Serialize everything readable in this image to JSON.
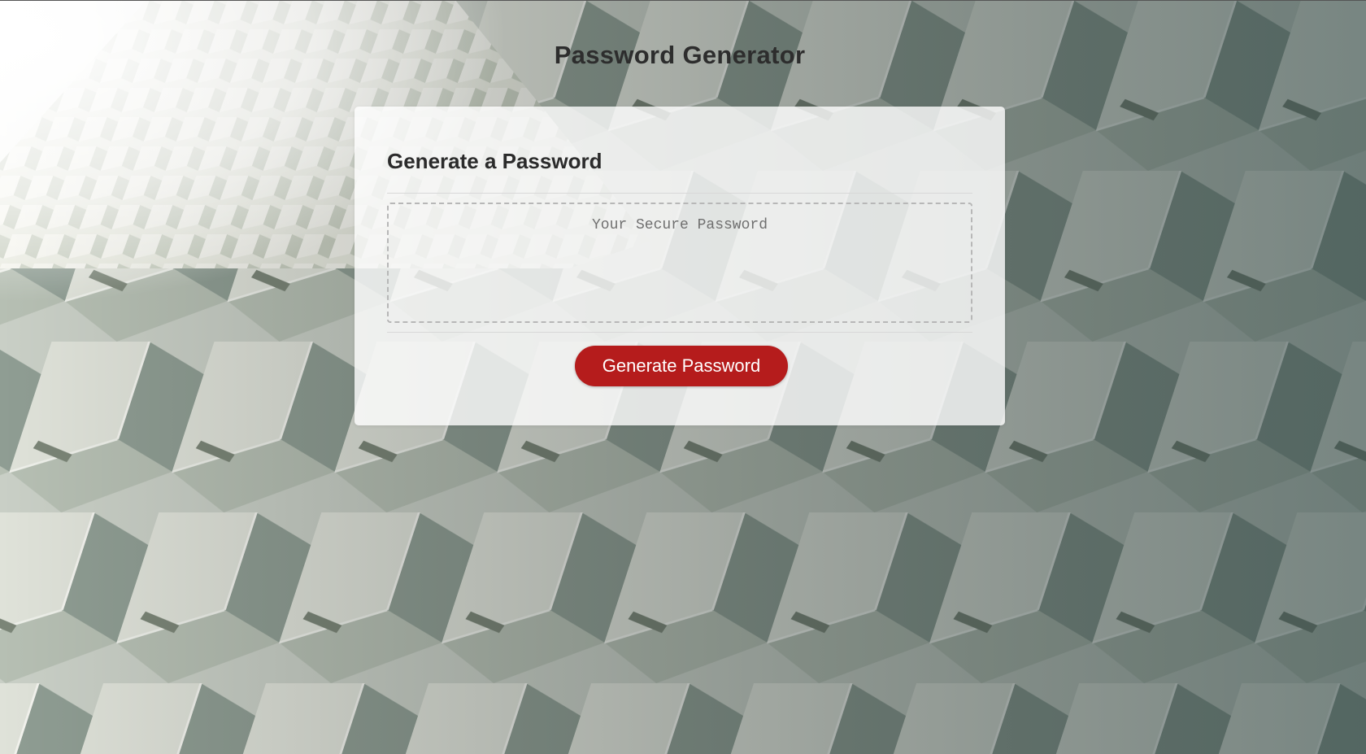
{
  "page": {
    "title": "Password Generator"
  },
  "card": {
    "title": "Generate a Password",
    "password_placeholder": "Your Secure Password",
    "password_value": "",
    "generate_button_label": "Generate Password"
  },
  "colors": {
    "accent": "#b51c1c",
    "title_text": "#2d2d2d",
    "card_background": "#ffffffcc",
    "dashed_border": "#b7b7b7"
  }
}
